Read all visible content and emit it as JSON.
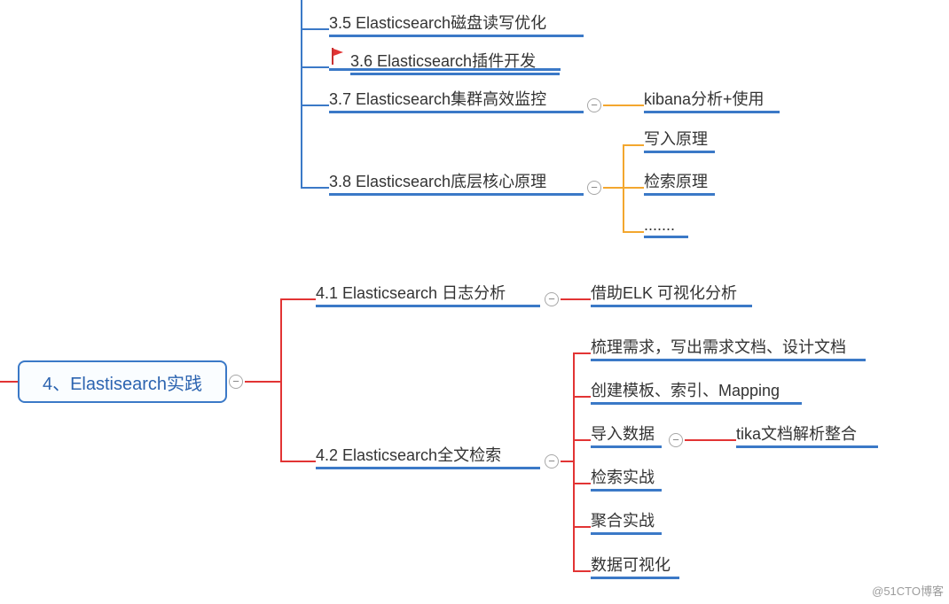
{
  "root": {
    "label": "4、Elastisearch实践"
  },
  "section3": {
    "n35": "3.5 Elasticsearch磁盘读写优化",
    "n36": "3.6 Elasticsearch插件开发",
    "n37": "3.7 Elasticsearch集群高效监控",
    "n37_child": "kibana分析+使用",
    "n38": "3.8 Elasticsearch底层核心原理",
    "n38_children": [
      "写入原理",
      "检索原理",
      "......."
    ]
  },
  "section4": {
    "n41": "4.1 Elasticsearch 日志分析",
    "n41_child": "借助ELK 可视化分析",
    "n42": "4.2 Elasticsearch全文检索",
    "n42_children": [
      "梳理需求，写出需求文档、设计文档",
      "创建模板、索引、Mapping",
      "导入数据",
      "检索实战",
      "聚合实战",
      "数据可视化"
    ],
    "n42_c3_child": "tika文档解析整合"
  },
  "watermark": "@51CTO博客",
  "colors": {
    "blue": "#3b79c7",
    "orange": "#f3a72e",
    "red": "#e23434"
  }
}
